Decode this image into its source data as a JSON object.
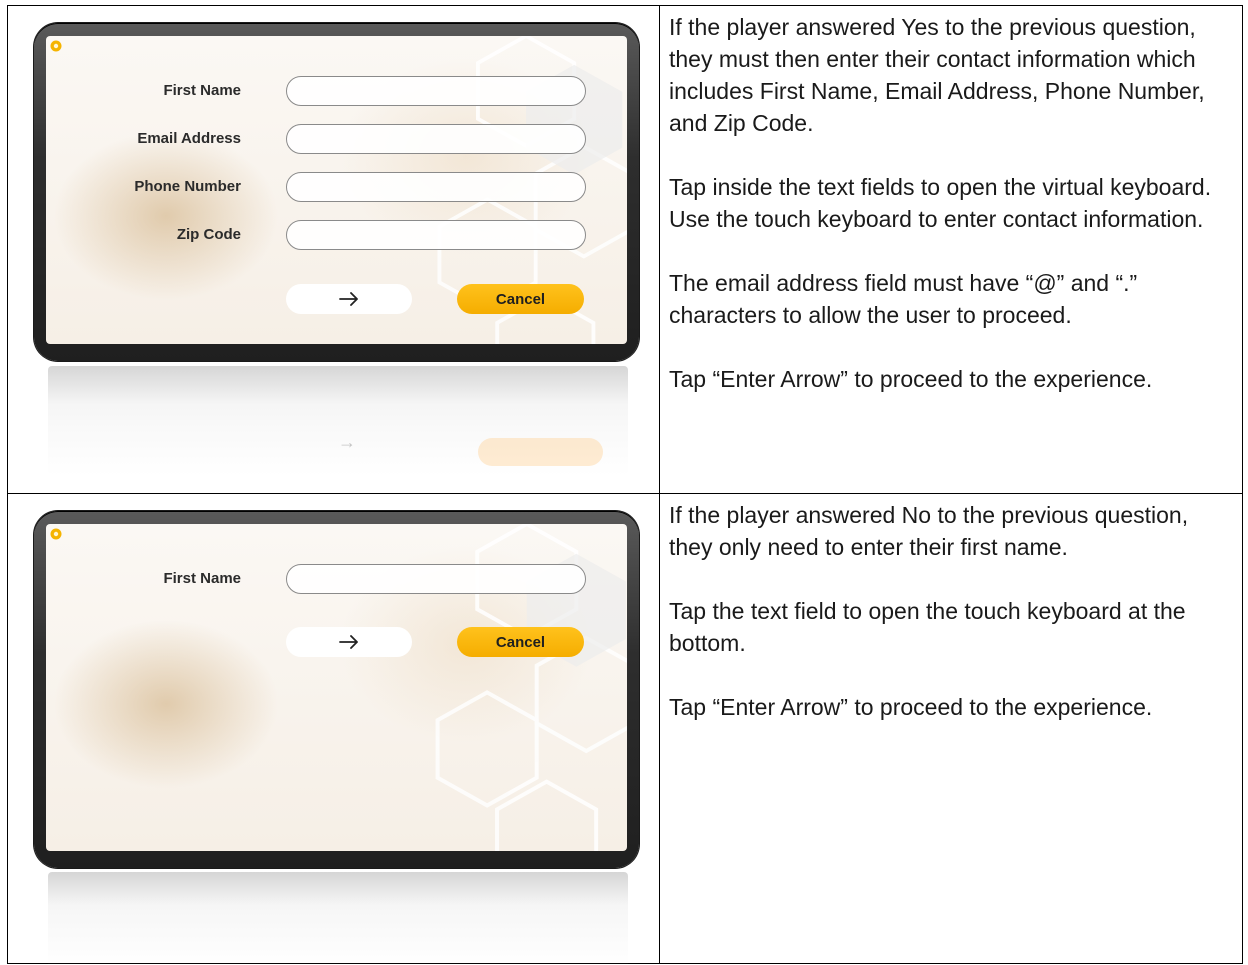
{
  "rows": [
    {
      "mockup": {
        "fields": [
          "First Name",
          "Email Address",
          "Phone Number",
          "Zip Code"
        ],
        "enter_icon": "arrow-right-icon",
        "cancel_label": "Cancel"
      },
      "paragraphs": [
        "If the player answered Yes to the previous question, they must then enter their contact information which includes First Name, Email Address, Phone Number, and Zip Code.",
        "Tap inside the text fields to open the virtual keyboard. Use the touch keyboard to enter contact information.",
        "The email address field must have “@” and “.” characters to allow the user to proceed.",
        "Tap “Enter Arrow” to proceed to the experience."
      ]
    },
    {
      "mockup": {
        "fields": [
          "First Name"
        ],
        "enter_icon": "arrow-right-icon",
        "cancel_label": "Cancel"
      },
      "paragraphs": [
        "If the player answered No to the previous question, they only need to enter their first name.",
        "Tap the text field to open the touch keyboard at the bottom.",
        "Tap “Enter Arrow” to proceed to the experience."
      ]
    }
  ],
  "colors": {
    "accent": "#f8b400",
    "bezel": "#2a2a2a",
    "border": "#000000"
  }
}
